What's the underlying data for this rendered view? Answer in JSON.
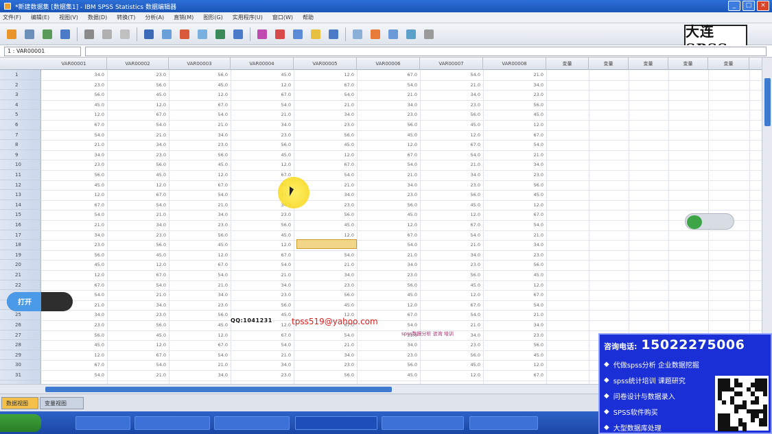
{
  "window": {
    "title": "*新建数据集 [数据集1] - IBM SPSS Statistics 数据编辑器",
    "controls": [
      "_",
      "□",
      "×"
    ]
  },
  "menu": [
    "文件(F)",
    "编辑(E)",
    "视图(V)",
    "数据(D)",
    "转换(T)",
    "分析(A)",
    "直销(M)",
    "图形(G)",
    "实用程序(U)",
    "窗口(W)",
    "帮助"
  ],
  "logo_text": "大连SPSS",
  "refbar": {
    "cell_ref": "1 : VAR00001",
    "value": ""
  },
  "columns": [
    "VAR00001",
    "VAR00002",
    "VAR00003",
    "VAR00004",
    "VAR00005",
    "VAR00006",
    "VAR00007",
    "VAR00008",
    "变量",
    "变量",
    "变量",
    "变量",
    "变量"
  ],
  "rows": [
    "1",
    "2",
    "3",
    "4",
    "5",
    "6",
    "7",
    "8",
    "9",
    "10",
    "11",
    "12",
    "13",
    "14",
    "15",
    "16",
    "17",
    "18",
    "19",
    "20",
    "21",
    "22",
    "23",
    "24",
    "25",
    "26",
    "27",
    "28",
    "29",
    "30",
    "31"
  ],
  "cell_values": [
    "34.0",
    "23.0",
    "56.0",
    "45.0",
    "12.0",
    "67.0",
    "54.0",
    "21.0"
  ],
  "tabs": {
    "data_view": "数据视图",
    "variable_view": "变量视图"
  },
  "overlay": {
    "pill_label": "打开",
    "annot_black": "QQ:1041231",
    "annot_red": "tpss519@yahoo.com",
    "annot_pink": "spss数据分析 咨询 培训"
  },
  "promo": {
    "phone_label": "咨询电话:",
    "phone": "15022275006",
    "items": [
      "代做spss分析  企业数据挖掘",
      "spss统计培训  课题研究",
      "问卷设计与数据录入",
      "SPSS软件购买",
      "大型数据库处理"
    ]
  },
  "colors": {
    "accent": "#1a2fd6",
    "scroll": "#3d7ad0",
    "highlight": "#f5d41a"
  }
}
